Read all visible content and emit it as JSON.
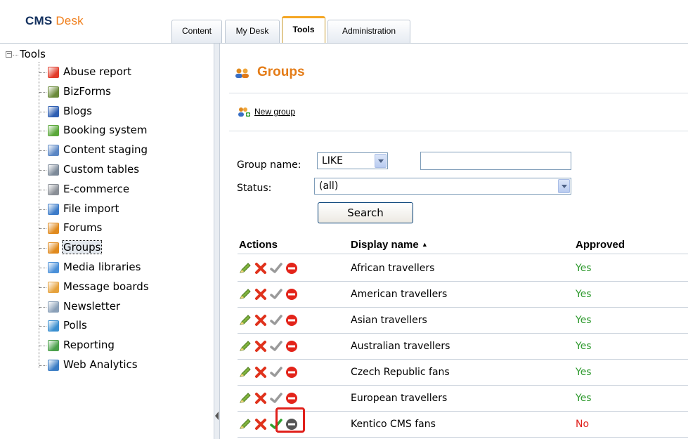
{
  "header": {
    "logo_bold": "CMS",
    "logo_rest": "Desk",
    "tabs": [
      {
        "label": "Content"
      },
      {
        "label": "My Desk"
      },
      {
        "label": "Tools"
      },
      {
        "label": "Administration"
      }
    ],
    "active_tab": "Tools"
  },
  "tree": {
    "root": {
      "label": "Tools",
      "expander": "−"
    },
    "items": [
      {
        "label": "Abuse report",
        "icon": "abuse-report-icon",
        "color": "#e23b2a"
      },
      {
        "label": "BizForms",
        "icon": "bizforms-icon",
        "color": "#6a8a3a"
      },
      {
        "label": "Blogs",
        "icon": "blogs-icon",
        "color": "#2f5fb3"
      },
      {
        "label": "Booking system",
        "icon": "booking-system-icon",
        "color": "#5aa83a"
      },
      {
        "label": "Content staging",
        "icon": "content-staging-icon",
        "color": "#5b87c5"
      },
      {
        "label": "Custom tables",
        "icon": "custom-tables-icon",
        "color": "#7d8a99"
      },
      {
        "label": "E-commerce",
        "icon": "ecommerce-icon",
        "color": "#8a8f96"
      },
      {
        "label": "File import",
        "icon": "file-import-icon",
        "color": "#3d7cc9"
      },
      {
        "label": "Forums",
        "icon": "forums-icon",
        "color": "#e08a1e"
      },
      {
        "label": "Groups",
        "icon": "groups-icon",
        "color": "#e08a1e"
      },
      {
        "label": "Media libraries",
        "icon": "media-libraries-icon",
        "color": "#4a90d9"
      },
      {
        "label": "Message boards",
        "icon": "message-boards-icon",
        "color": "#e6a23c"
      },
      {
        "label": "Newsletter",
        "icon": "newsletter-icon",
        "color": "#8aa0b8"
      },
      {
        "label": "Polls",
        "icon": "polls-icon",
        "color": "#3a8fd0"
      },
      {
        "label": "Reporting",
        "icon": "reporting-icon",
        "color": "#4aa04a"
      },
      {
        "label": "Web Analytics",
        "icon": "web-analytics-icon",
        "color": "#3a7cc4"
      }
    ],
    "selected": "Groups"
  },
  "page": {
    "title": "Groups",
    "title_icon": "groups-icon",
    "title_color": "#e47c17",
    "new_group_label": "New group",
    "new_group_icon": "new-group-icon"
  },
  "filter": {
    "group_name_label": "Group name:",
    "group_name_operator": "LIKE",
    "group_name_value": "",
    "status_label": "Status:",
    "status_value": "(all)",
    "search_label": "Search"
  },
  "grid": {
    "headers": {
      "actions": "Actions",
      "display_name": "Display name",
      "sort_indicator": "▲",
      "approved": "Approved"
    },
    "action_icons": [
      "edit-icon",
      "delete-icon",
      "approve-icon",
      "reject-icon"
    ],
    "colors": {
      "yes": "#2f9a2f",
      "no": "#e0201b",
      "highlight": "#e0201b"
    },
    "rows": [
      {
        "name": "African travellers",
        "approved": "Yes",
        "is_approved": true
      },
      {
        "name": "American travellers",
        "approved": "Yes",
        "is_approved": true
      },
      {
        "name": "Asian travellers",
        "approved": "Yes",
        "is_approved": true
      },
      {
        "name": "Australian travellers",
        "approved": "Yes",
        "is_approved": true
      },
      {
        "name": "Czech Republic fans",
        "approved": "Yes",
        "is_approved": true
      },
      {
        "name": "European travellers",
        "approved": "Yes",
        "is_approved": true
      },
      {
        "name": "Kentico CMS fans",
        "approved": "No",
        "is_approved": false
      }
    ]
  }
}
